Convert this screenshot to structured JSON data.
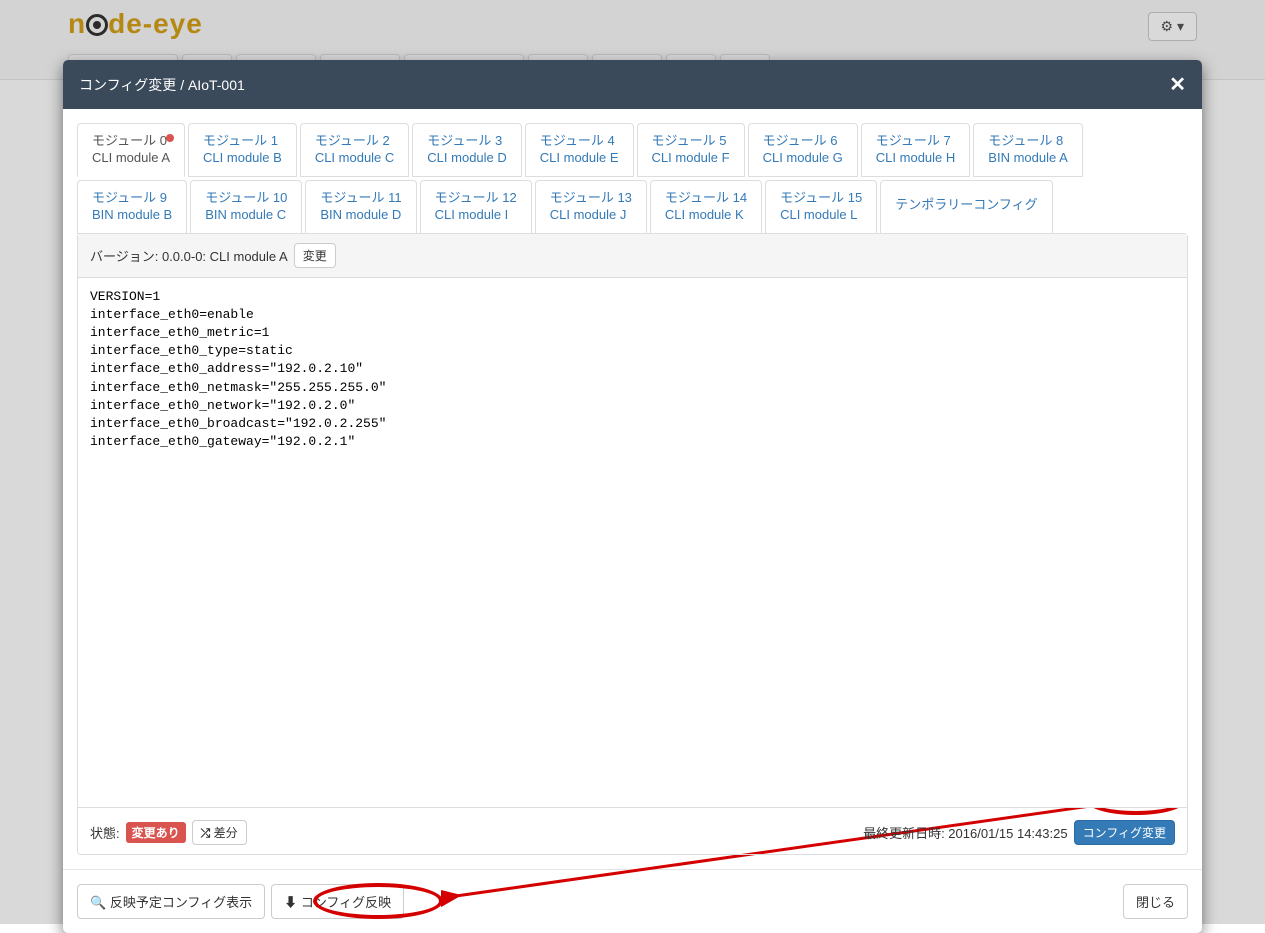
{
  "header": {
    "logo_text_left": "n",
    "logo_text_mid": "de-eye",
    "gear_label": "⚙ ▾"
  },
  "modal": {
    "title": "コンフィグ変更 / AIoT-001",
    "close": "✕"
  },
  "tabs": {
    "items": [
      {
        "line1": "モジュール 0",
        "line2": "CLI module A",
        "active": true,
        "dot": true
      },
      {
        "line1": "モジュール 1",
        "line2": "CLI module B"
      },
      {
        "line1": "モジュール 2",
        "line2": "CLI module C"
      },
      {
        "line1": "モジュール 3",
        "line2": "CLI module D"
      },
      {
        "line1": "モジュール 4",
        "line2": "CLI module E"
      },
      {
        "line1": "モジュール 5",
        "line2": "CLI module F"
      },
      {
        "line1": "モジュール 6",
        "line2": "CLI module G"
      },
      {
        "line1": "モジュール 7",
        "line2": "CLI module H"
      },
      {
        "line1": "モジュール 8",
        "line2": "BIN module A"
      },
      {
        "line1": "モジュール 9",
        "line2": "BIN module B"
      },
      {
        "line1": "モジュール 10",
        "line2": "BIN module C"
      },
      {
        "line1": "モジュール 11",
        "line2": "BIN module D"
      },
      {
        "line1": "モジュール 12",
        "line2": "CLI module I"
      },
      {
        "line1": "モジュール 13",
        "line2": "CLI module J"
      },
      {
        "line1": "モジュール 14",
        "line2": "CLI module K"
      },
      {
        "line1": "モジュール 15",
        "line2": "CLI module L"
      }
    ],
    "temp_label": "テンポラリーコンフィグ"
  },
  "panel": {
    "version_label": "バージョン: 0.0.0-0: CLI module A",
    "change_btn": "変更",
    "config_text": "VERSION=1\ninterface_eth0=enable\ninterface_eth0_metric=1\ninterface_eth0_type=static\ninterface_eth0_address=\"192.0.2.10\"\ninterface_eth0_netmask=\"255.255.255.0\"\ninterface_eth0_network=\"192.0.2.0\"\ninterface_eth0_broadcast=\"192.0.2.255\"\ninterface_eth0_gateway=\"192.0.2.1\"",
    "status_label": "状態:",
    "status_badge": "変更あり",
    "diff_btn": "差分",
    "updated_label": "最終更新日時: 2016/01/15 14:43:25",
    "apply_btn": "コンフィグ変更"
  },
  "footer": {
    "show_pending_btn": "反映予定コンフィグ表示",
    "reflect_btn": "コンフィグ反映",
    "close_btn": "閉じる"
  }
}
